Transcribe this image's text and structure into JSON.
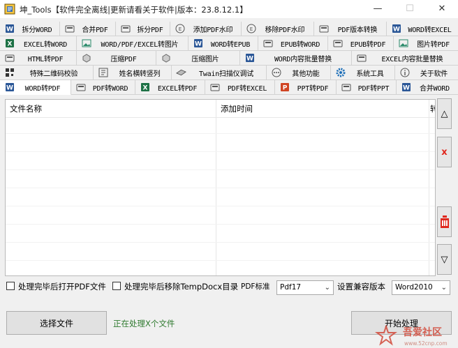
{
  "window": {
    "title": "坤_Tools【软件完全离线|更新请看关于软件|版本：23.8.12.1】",
    "minimize": "—",
    "maximize": "☐",
    "close": "✕"
  },
  "tabs_row1": [
    {
      "label": "拆分WORD",
      "icon": "word-icon"
    },
    {
      "label": "合并PDF",
      "icon": "pdf-icon"
    },
    {
      "label": "拆分PDF",
      "icon": "pdf-icon"
    },
    {
      "label": "添加PDF水印",
      "icon": "watermark-icon"
    },
    {
      "label": "移除PDF水印",
      "icon": "watermark-icon"
    },
    {
      "label": "PDF版本转换",
      "icon": "pdf-icon"
    },
    {
      "label": "WORD转EXCEL",
      "icon": "word-icon"
    }
  ],
  "tabs_row2": [
    {
      "label": "EXCEL转WORD",
      "icon": "excel-icon"
    },
    {
      "label": "WORD/PDF/EXCEL转图片",
      "icon": "image-icon"
    },
    {
      "label": "WORD转EPUB",
      "icon": "word-icon"
    },
    {
      "label": "EPUB转WORD",
      "icon": "pdf-icon"
    },
    {
      "label": "EPUB转PDF",
      "icon": "pdf-icon"
    },
    {
      "label": "图片转PDF",
      "icon": "image-icon"
    }
  ],
  "tabs_row3": [
    {
      "label": "HTML转PDF",
      "icon": "pdf-icon"
    },
    {
      "label": "压缩PDF",
      "icon": "compress-icon"
    },
    {
      "label": "压缩图片",
      "icon": "compress-icon"
    },
    {
      "label": "WORD内容批量替换",
      "icon": "word-icon"
    },
    {
      "label": "EXCEL内容批量替换",
      "icon": "pdf-icon"
    }
  ],
  "tabs_row4": [
    {
      "label": "特殊二维码校验",
      "icon": "qrcode-icon"
    },
    {
      "label": "姓名横转竖列",
      "icon": "name-icon"
    },
    {
      "label": "Twain扫描仪调试",
      "icon": "scanner-icon"
    },
    {
      "label": "其他功能",
      "icon": "more-icon"
    },
    {
      "label": "系统工具",
      "icon": "gear-icon"
    },
    {
      "label": "关于软件",
      "icon": "info-icon"
    }
  ],
  "tabs_row5": [
    {
      "label": "WORD转PDF",
      "icon": "word-icon",
      "active": true
    },
    {
      "label": "PDF转WORD",
      "icon": "pdf-icon"
    },
    {
      "label": "EXCEL转PDF",
      "icon": "excel-icon"
    },
    {
      "label": "PDF转EXCEL",
      "icon": "pdf-icon"
    },
    {
      "label": "PPT转PDF",
      "icon": "ppt-icon"
    },
    {
      "label": "PDF转PPT",
      "icon": "pdf-icon"
    },
    {
      "label": "合并WORD",
      "icon": "word-icon"
    }
  ],
  "file_list": {
    "columns": [
      "文件名称",
      "添加时间",
      "转"
    ],
    "rows": []
  },
  "side_buttons": {
    "move_up": "△",
    "remove": "x",
    "clear": "clear-icon",
    "move_down": "▽"
  },
  "options": {
    "open_pdf_after": "处理完毕后打开PDF文件",
    "remove_tempdocx_after": "处理完毕后移除TempDocx目录",
    "pdf_standard_label": "PDF标准",
    "pdf_standard_value": "Pdf17",
    "compat_label": "设置兼容版本",
    "compat_value": "Word2010"
  },
  "bottom": {
    "select_files": "选择文件",
    "status": "正在处理X个文件",
    "start": "开始处理"
  },
  "watermark": {
    "text": "吾爱社区",
    "url": "www.52cnp.com"
  },
  "colors": {
    "word": "#2b5797",
    "excel": "#1d7145",
    "ppt": "#d04423",
    "pdf": "#555555",
    "status_green": "#2f7a2f",
    "remove_red": "#e0281e"
  }
}
